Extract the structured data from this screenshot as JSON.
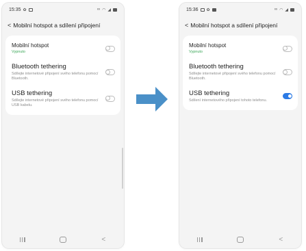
{
  "colors": {
    "arrow": "#4a90c8",
    "toggle_on": "#2c7be5",
    "subtitle_green": "#3aa657"
  },
  "before": {
    "status": {
      "time": "15:35",
      "left_icons": [
        "gear-icon",
        "picture-icon"
      ],
      "right_icons": [
        "link-icon",
        "wifi-icon",
        "signal-icon",
        "battery-icon"
      ]
    },
    "header": {
      "back": "<",
      "title": "Mobilní hotspot a sdílení připojení"
    },
    "items": [
      {
        "title": "Mobilní hotspot",
        "subtitle": "Vypnuto",
        "toggle_on": false
      },
      {
        "title": "Bluetooth tethering",
        "subtitle": "Sdílejte internetové připojení svého telefonu pomocí Bluetooth.",
        "toggle_on": false
      },
      {
        "title": "USB tethering",
        "subtitle": "Sdílejte internetové připojení svého telefonu pomocí USB kabelu.",
        "toggle_on": false
      }
    ]
  },
  "after": {
    "status": {
      "time": "15:36",
      "left_icons": [
        "picture-icon",
        "gear-icon",
        "notification-icon"
      ],
      "right_icons": [
        "link-icon",
        "wifi-icon",
        "signal-icon",
        "battery-icon"
      ]
    },
    "header": {
      "back": "<",
      "title": "Mobilní hotspot a sdílení připojení"
    },
    "items": [
      {
        "title": "Mobilní hotspot",
        "subtitle": "Vypnuto",
        "toggle_on": false
      },
      {
        "title": "Bluetooth tethering",
        "subtitle": "Sdílejte internetové připojení svého telefonu pomocí Bluetooth.",
        "toggle_on": false
      },
      {
        "title": "USB tethering",
        "subtitle": "Sdílení internetového připojení tohoto telefonu.",
        "toggle_on": true
      }
    ]
  },
  "navbar": {
    "recent": "recent-apps-icon",
    "home": "home-icon",
    "back": "<"
  }
}
